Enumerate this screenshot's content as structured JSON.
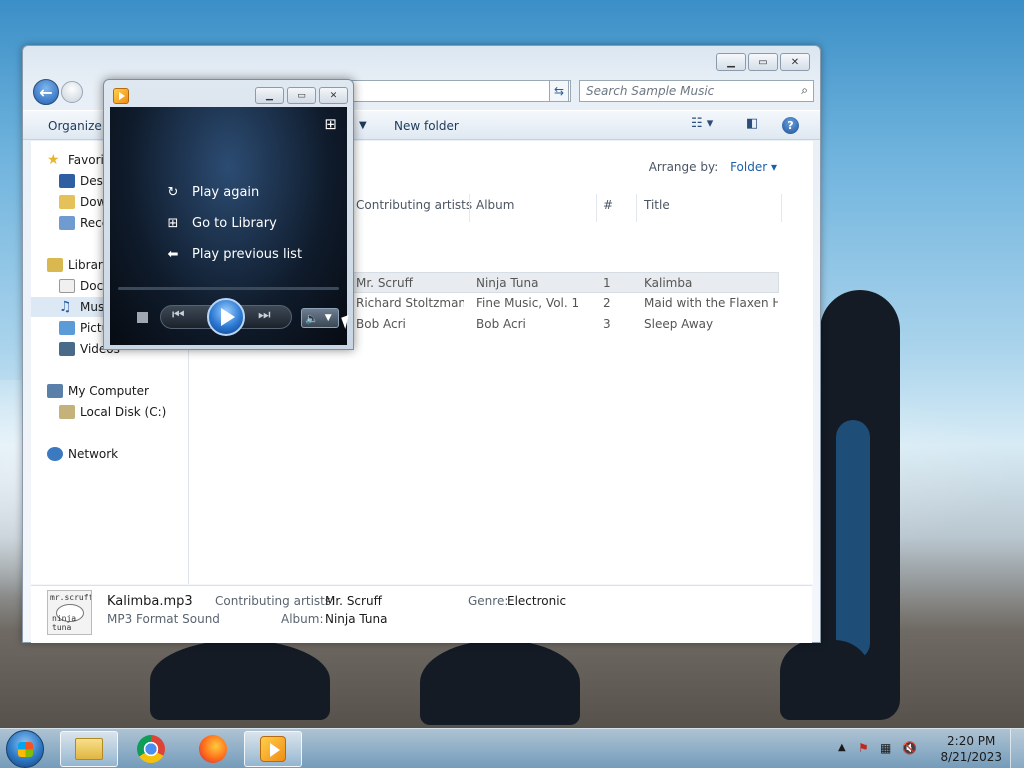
{
  "explorer": {
    "search_placeholder": "Search Sample Music",
    "toolbar": {
      "organize": "Organize",
      "new_folder": "New folder"
    },
    "nav": {
      "favorites": "Favorites",
      "desktop": "Desktop",
      "downloads": "Downloads",
      "recent": "Recent Places",
      "libraries": "Libraries",
      "documents": "Documents",
      "music": "Music",
      "pictures": "Pictures",
      "videos": "Videos",
      "my_computer": "My Computer",
      "local_disk": "Local Disk (C:)",
      "network": "Network"
    },
    "arrange_label": "Arrange by:",
    "arrange_value": "Folder",
    "columns": {
      "artists": "Contributing artists",
      "album": "Album",
      "number": "#",
      "title": "Title"
    },
    "rows": [
      {
        "artist": "Mr. Scruff",
        "album": "Ninja Tuna",
        "number": "1",
        "title": "Kalimba"
      },
      {
        "artist": "Richard Stoltzman...",
        "album": "Fine Music, Vol. 1",
        "number": "2",
        "title": "Maid with the Flaxen H..."
      },
      {
        "artist": "Bob Acri",
        "album": "Bob Acri",
        "number": "3",
        "title": "Sleep Away"
      }
    ],
    "details": {
      "filename": "Kalimba.mp3",
      "filetype": "MP3 Format Sound",
      "artists_label": "Contributing artists:",
      "artists_value": "Mr. Scruff",
      "album_label": "Album:",
      "album_value": "Ninja Tuna",
      "genre_label": "Genre:",
      "genre_value": "Electronic",
      "art_line1": "mr.scruff",
      "art_line2": "ninja tuna"
    }
  },
  "wmp": {
    "menu": {
      "play_again": "Play again",
      "go_to_library": "Go to Library",
      "play_previous": "Play previous list"
    }
  },
  "taskbar": {
    "time": "2:20 PM",
    "date": "8/21/2023"
  },
  "colors": {
    "accent": "#1b5fae",
    "wmp_bg": "#0f1b2b",
    "taskbar": "#8fb6d6"
  }
}
